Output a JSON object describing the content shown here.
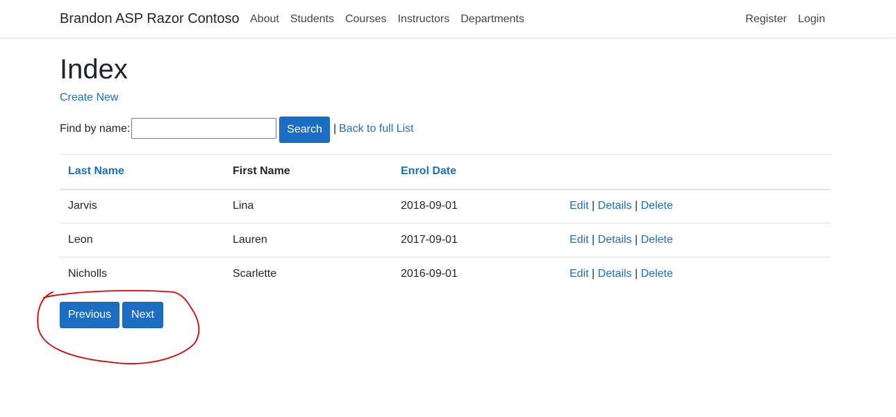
{
  "nav": {
    "brand": "Brandon ASP Razor Contoso",
    "left_links": [
      "About",
      "Students",
      "Courses",
      "Instructors",
      "Departments"
    ],
    "right_links": [
      "Register",
      "Login"
    ]
  },
  "page": {
    "title": "Index",
    "create_link": "Create New"
  },
  "search": {
    "label": "Find by name:",
    "value": "",
    "button": "Search",
    "separator": "|",
    "back_link": "Back to full List"
  },
  "table": {
    "headers": {
      "last_name": "Last Name",
      "first_name": "First Name",
      "enrol_date": "Enrol Date"
    },
    "action_separator": "|",
    "rows": [
      {
        "last": "Jarvis",
        "first": "Lina",
        "date": "2018-09-01",
        "edit": "Edit",
        "details": "Details",
        "delete": "Delete"
      },
      {
        "last": "Leon",
        "first": "Lauren",
        "date": "2017-09-01",
        "edit": "Edit",
        "details": "Details",
        "delete": "Delete"
      },
      {
        "last": "Nicholls",
        "first": "Scarlette",
        "date": "2016-09-01",
        "edit": "Edit",
        "details": "Details",
        "delete": "Delete"
      }
    ]
  },
  "pager": {
    "previous": "Previous",
    "next": "Next"
  },
  "colors": {
    "link": "#1b6ec2",
    "button": "#1b6ec2",
    "annotation": "#e00000"
  }
}
